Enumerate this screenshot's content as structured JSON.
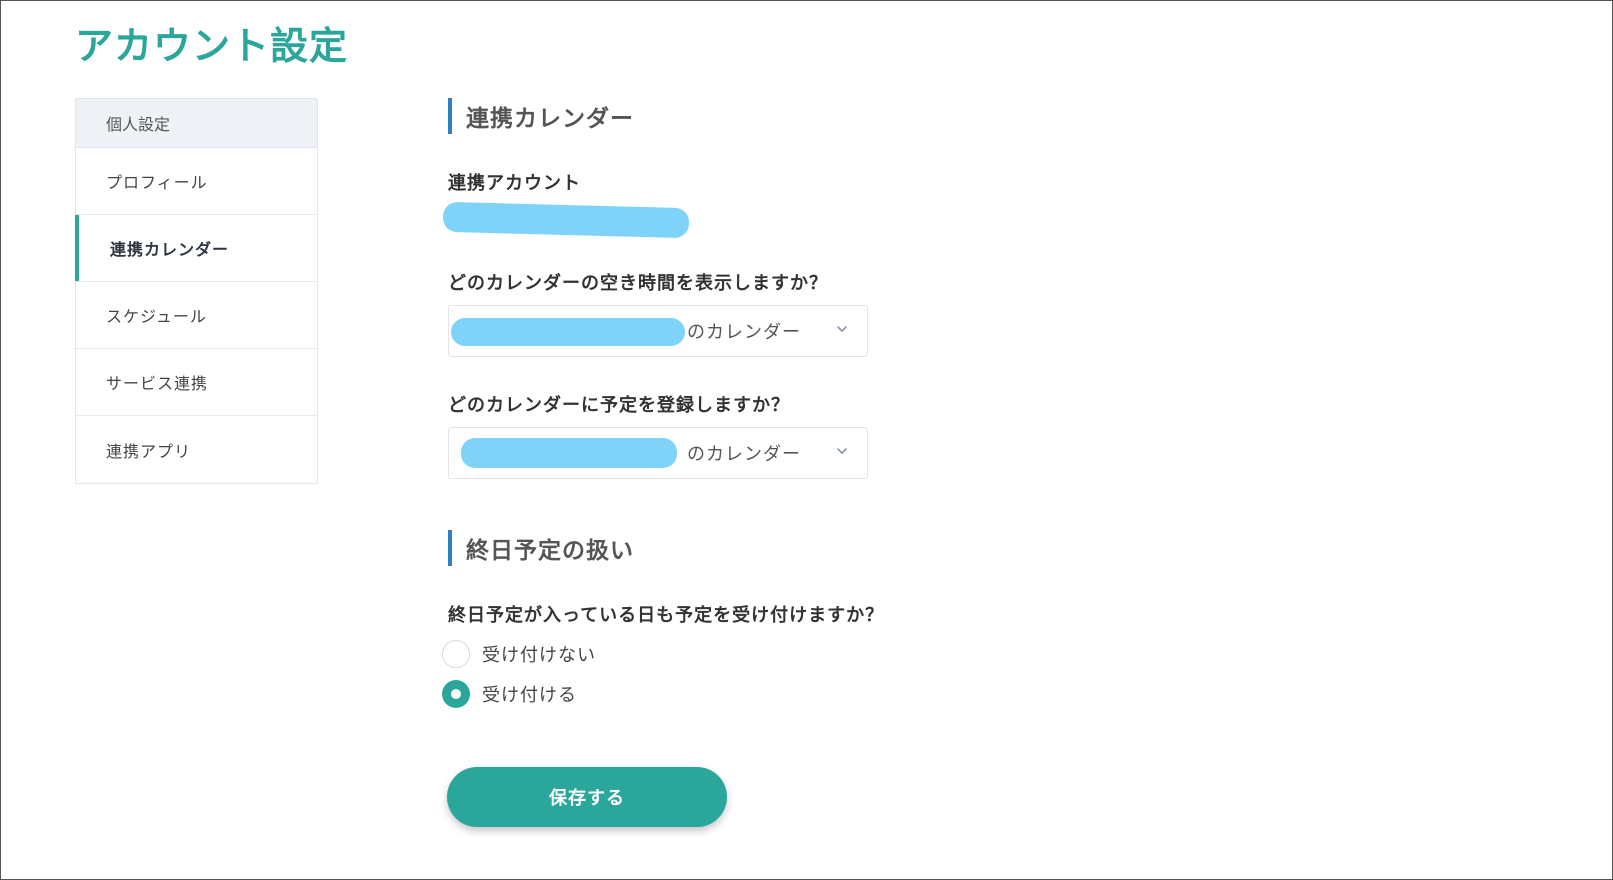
{
  "page": {
    "title": "アカウント設定"
  },
  "sidebar": {
    "header": "個人設定",
    "items": [
      {
        "label": "プロフィール",
        "active": false
      },
      {
        "label": "連携カレンダー",
        "active": true
      },
      {
        "label": "スケジュール",
        "active": false
      },
      {
        "label": "サービス連携",
        "active": false
      },
      {
        "label": "連携アプリ",
        "active": false
      }
    ]
  },
  "calendar_section": {
    "heading": "連携カレンダー",
    "account_label": "連携アカウント",
    "availability_question": "どのカレンダーの空き時間を表示しますか？",
    "availability_select_suffix": "のカレンダー",
    "register_question": "どのカレンダーに予定を登録しますか？",
    "register_select_suffix": "のカレンダー"
  },
  "allday_section": {
    "heading": "終日予定の扱い",
    "question": "終日予定が入っている日も予定を受け付けますか？",
    "options": [
      {
        "label": "受け付けない",
        "checked": false
      },
      {
        "label": "受け付ける",
        "checked": true
      }
    ]
  },
  "actions": {
    "save_label": "保存する"
  },
  "colors": {
    "accent": "#2aa69a",
    "heading_bar": "#2c7fc1",
    "redaction": "#7fd3f9"
  },
  "icons": {
    "select_chevron": "chevron-down-icon"
  }
}
